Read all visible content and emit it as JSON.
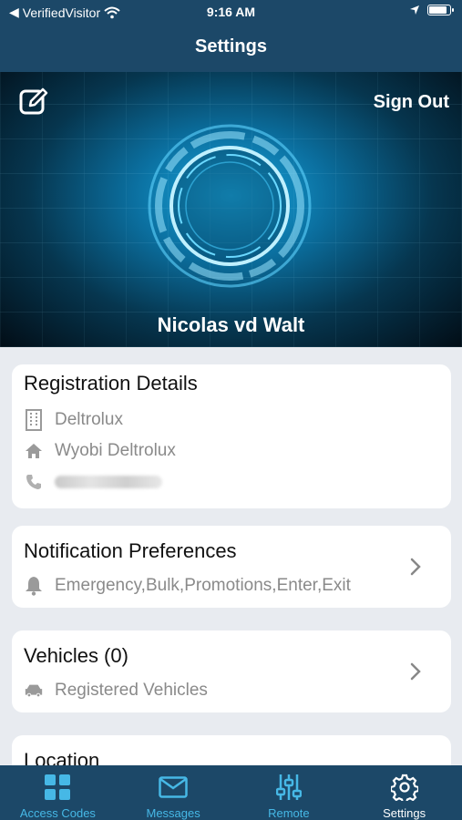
{
  "status_bar": {
    "back_app": "VerifiedVisitor",
    "time": "9:16 AM",
    "battery_level": 0.92
  },
  "header": {
    "title": "Settings"
  },
  "profile": {
    "sign_out_label": "Sign Out",
    "name": "Nicolas vd Walt",
    "edit_icon": "edit-icon"
  },
  "registration": {
    "title": "Registration Details",
    "company": "Deltrolux",
    "home": "Wyobi Deltrolux",
    "phone_redacted": true
  },
  "notifications": {
    "title": "Notification Preferences",
    "value": "Emergency,Bulk,Promotions,Enter,Exit"
  },
  "vehicles": {
    "title": "Vehicles (0)",
    "subtitle": "Registered Vehicles"
  },
  "location": {
    "title": "Location"
  },
  "tabs": [
    {
      "label": "Access Codes",
      "icon": "grid-icon",
      "active": false
    },
    {
      "label": "Messages",
      "icon": "mail-icon",
      "active": false
    },
    {
      "label": "Remote",
      "icon": "sliders-icon",
      "active": false
    },
    {
      "label": "Settings",
      "icon": "gear-icon",
      "active": true
    }
  ],
  "colors": {
    "bar": "#1c4868",
    "accent": "#46b8e6",
    "background": "#e8ebf0"
  }
}
